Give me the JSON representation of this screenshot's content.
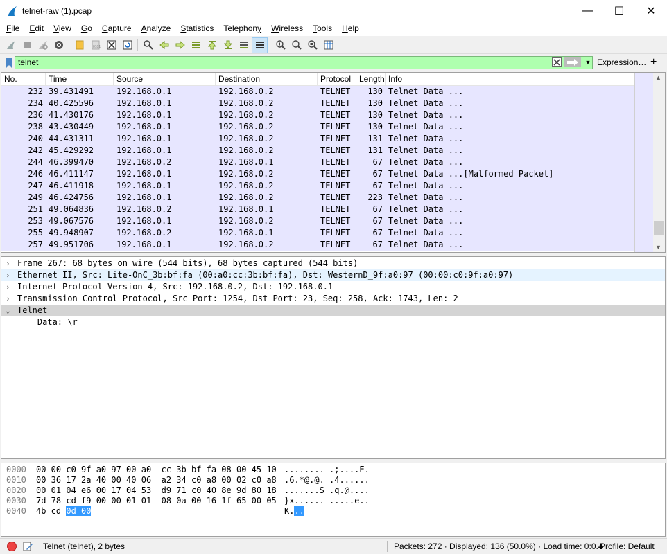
{
  "window": {
    "title": "telnet-raw (1).pcap",
    "minimize": "—",
    "maximize": "☐",
    "close": "✕"
  },
  "menu": [
    {
      "pre": "",
      "u": "F",
      "post": "ile"
    },
    {
      "pre": "",
      "u": "E",
      "post": "dit"
    },
    {
      "pre": "",
      "u": "V",
      "post": "iew"
    },
    {
      "pre": "",
      "u": "G",
      "post": "o"
    },
    {
      "pre": "",
      "u": "C",
      "post": "apture"
    },
    {
      "pre": "",
      "u": "A",
      "post": "nalyze"
    },
    {
      "pre": "",
      "u": "S",
      "post": "tatistics"
    },
    {
      "pre": "Telephon",
      "u": "y",
      "post": ""
    },
    {
      "pre": "",
      "u": "W",
      "post": "ireless"
    },
    {
      "pre": "",
      "u": "T",
      "post": "ools"
    },
    {
      "pre": "",
      "u": "H",
      "post": "elp"
    }
  ],
  "filter": {
    "value": "telnet",
    "expression_label": "Expression…",
    "add_label": "+"
  },
  "columns": [
    "No.",
    "Time",
    "Source",
    "Destination",
    "Protocol",
    "Length",
    "Info"
  ],
  "packets": [
    {
      "no": "232",
      "time": "39.431491",
      "src": "192.168.0.1",
      "dst": "192.168.0.2",
      "proto": "TELNET",
      "len": "130",
      "info": "Telnet Data ..."
    },
    {
      "no": "234",
      "time": "40.425596",
      "src": "192.168.0.1",
      "dst": "192.168.0.2",
      "proto": "TELNET",
      "len": "130",
      "info": "Telnet Data ..."
    },
    {
      "no": "236",
      "time": "41.430176",
      "src": "192.168.0.1",
      "dst": "192.168.0.2",
      "proto": "TELNET",
      "len": "130",
      "info": "Telnet Data ..."
    },
    {
      "no": "238",
      "time": "43.430449",
      "src": "192.168.0.1",
      "dst": "192.168.0.2",
      "proto": "TELNET",
      "len": "130",
      "info": "Telnet Data ..."
    },
    {
      "no": "240",
      "time": "44.431311",
      "src": "192.168.0.1",
      "dst": "192.168.0.2",
      "proto": "TELNET",
      "len": "131",
      "info": "Telnet Data ..."
    },
    {
      "no": "242",
      "time": "45.429292",
      "src": "192.168.0.1",
      "dst": "192.168.0.2",
      "proto": "TELNET",
      "len": "131",
      "info": "Telnet Data ..."
    },
    {
      "no": "244",
      "time": "46.399470",
      "src": "192.168.0.2",
      "dst": "192.168.0.1",
      "proto": "TELNET",
      "len": "67",
      "info": "Telnet Data ..."
    },
    {
      "no": "246",
      "time": "46.411147",
      "src": "192.168.0.1",
      "dst": "192.168.0.2",
      "proto": "TELNET",
      "len": "67",
      "info": "Telnet Data ...[Malformed Packet]"
    },
    {
      "no": "247",
      "time": "46.411918",
      "src": "192.168.0.1",
      "dst": "192.168.0.2",
      "proto": "TELNET",
      "len": "67",
      "info": "Telnet Data ..."
    },
    {
      "no": "249",
      "time": "46.424756",
      "src": "192.168.0.1",
      "dst": "192.168.0.2",
      "proto": "TELNET",
      "len": "223",
      "info": "Telnet Data ..."
    },
    {
      "no": "251",
      "time": "49.064836",
      "src": "192.168.0.2",
      "dst": "192.168.0.1",
      "proto": "TELNET",
      "len": "67",
      "info": "Telnet Data ..."
    },
    {
      "no": "253",
      "time": "49.067576",
      "src": "192.168.0.1",
      "dst": "192.168.0.2",
      "proto": "TELNET",
      "len": "67",
      "info": "Telnet Data ..."
    },
    {
      "no": "255",
      "time": "49.948907",
      "src": "192.168.0.2",
      "dst": "192.168.0.1",
      "proto": "TELNET",
      "len": "67",
      "info": "Telnet Data ..."
    },
    {
      "no": "257",
      "time": "49.951706",
      "src": "192.168.0.1",
      "dst": "192.168.0.2",
      "proto": "TELNET",
      "len": "67",
      "info": "Telnet Data ..."
    }
  ],
  "details": [
    {
      "arrow": "›",
      "text": "Frame 267: 68 bytes on wire (544 bits), 68 bytes captured (544 bits)",
      "state": ""
    },
    {
      "arrow": "›",
      "text": "Ethernet II, Src: Lite-OnC_3b:bf:fa (00:a0:cc:3b:bf:fa), Dst: WesternD_9f:a0:97 (00:00:c0:9f:a0:97)",
      "state": "hover"
    },
    {
      "arrow": "›",
      "text": "Internet Protocol Version 4, Src: 192.168.0.2, Dst: 192.168.0.1",
      "state": ""
    },
    {
      "arrow": "›",
      "text": "Transmission Control Protocol, Src Port: 1254, Dst Port: 23, Seq: 258, Ack: 1743, Len: 2",
      "state": ""
    },
    {
      "arrow": "⌄",
      "text": "Telnet",
      "state": "sel"
    },
    {
      "arrow": "",
      "text": "    Data: \\r",
      "state": ""
    }
  ],
  "hex": [
    {
      "off": "0000",
      "bytes": "00 00 c0 9f a0 97 00 a0  cc 3b bf fa 08 00 45 10",
      "ascii": "........ .;....E."
    },
    {
      "off": "0010",
      "bytes": "00 36 17 2a 40 00 40 06  a2 34 c0 a8 00 02 c0 a8",
      "ascii": ".6.*@.@. .4......"
    },
    {
      "off": "0020",
      "bytes": "00 01 04 e6 00 17 04 53  d9 71 c0 40 8e 9d 80 18",
      "ascii": ".......S .q.@...."
    },
    {
      "off": "0030",
      "bytes": "7d 78 cd f9 00 00 01 01  08 0a 00 16 1f 65 00 05",
      "ascii": "}x...... .....e.."
    }
  ],
  "hex_last": {
    "off": "0040",
    "bytes_plain": "4b cd ",
    "bytes_hl": "0d 00",
    "ascii_plain": "K.",
    "ascii_hl": ".."
  },
  "status": {
    "field": "Telnet (telnet), 2 bytes",
    "packets": "Packets: 272 · Displayed: 136 (50.0%) · Load time: 0:0.4",
    "profile": "Profile: Default"
  }
}
